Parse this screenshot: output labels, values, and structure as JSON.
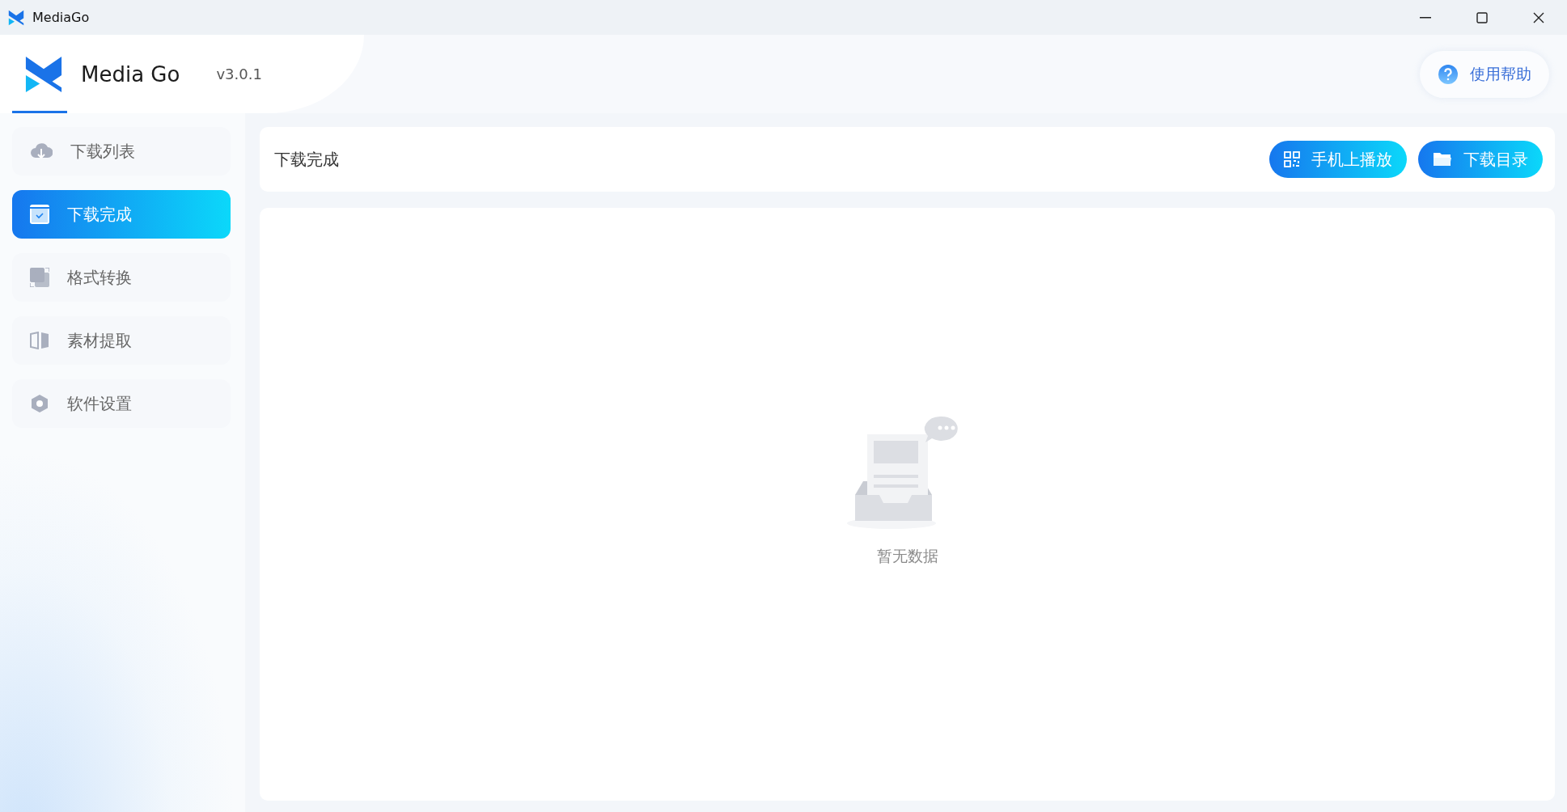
{
  "window": {
    "title": "MediaGo"
  },
  "header": {
    "app_name": "Media Go",
    "version": "v3.0.1",
    "help_button": "使用帮助"
  },
  "sidebar": {
    "items": [
      {
        "label": "下载列表",
        "kind": "cloud",
        "selected": false
      },
      {
        "label": "下载完成",
        "kind": "done",
        "selected": true
      },
      {
        "label": "格式转换",
        "kind": "convert",
        "selected": false
      },
      {
        "label": "素材提取",
        "kind": "extract",
        "selected": false
      },
      {
        "label": "软件设置",
        "kind": "settings",
        "selected": false
      }
    ]
  },
  "page": {
    "title": "下载完成",
    "buttons": [
      {
        "label": "手机上播放",
        "kind": "qr"
      },
      {
        "label": "下载目录",
        "kind": "folder"
      }
    ]
  },
  "empty_state": {
    "message": "暂无数据"
  }
}
